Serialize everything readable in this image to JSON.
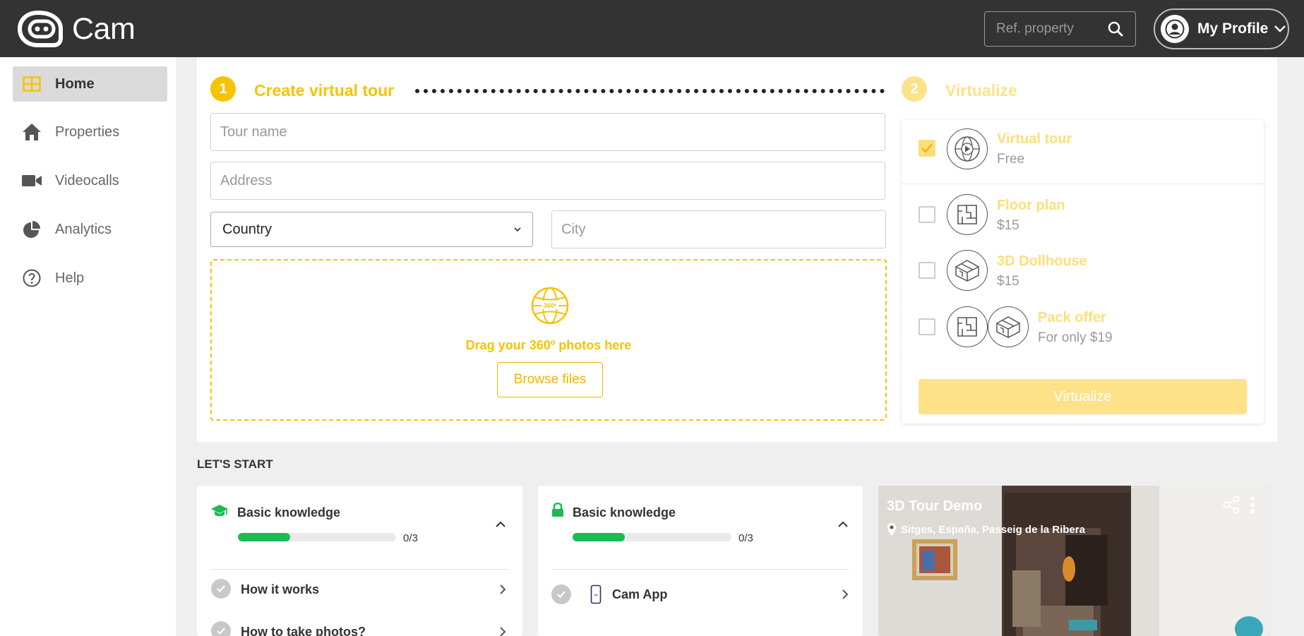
{
  "header": {
    "brand": "Cam",
    "search_placeholder": "Ref. property",
    "profile_label": "My Profile"
  },
  "sidebar": {
    "items": [
      {
        "label": "Home",
        "icon": "grid-icon",
        "active": true
      },
      {
        "label": "Properties",
        "icon": "house-icon",
        "active": false
      },
      {
        "label": "Videocalls",
        "icon": "video-icon",
        "active": false
      },
      {
        "label": "Analytics",
        "icon": "pie-chart-icon",
        "active": false
      },
      {
        "label": "Help",
        "icon": "help-icon",
        "active": false
      }
    ]
  },
  "create": {
    "step_number": "1",
    "title": "Create virtual tour",
    "tour_name_placeholder": "Tour name",
    "address_placeholder": "Address",
    "country_value": "Country",
    "city_placeholder": "City",
    "drop_text": "Drag your 360º photos here",
    "browse_label": "Browse files"
  },
  "virtualize": {
    "step_number": "2",
    "title": "Virtualize",
    "options": [
      {
        "title": "Virtual tour",
        "subtitle": "Free",
        "checked": true
      },
      {
        "title": "Floor plan",
        "subtitle": "$15",
        "checked": false
      },
      {
        "title": "3D Dollhouse",
        "subtitle": "$15",
        "checked": false
      },
      {
        "title": "Pack offer",
        "subtitle": "For only $19",
        "checked": false
      }
    ],
    "button_label": "Virtualize"
  },
  "lets_start": {
    "heading": "LET'S START",
    "cards": [
      {
        "title": "Basic knowledge",
        "progress": 0.33,
        "count": "0/3",
        "items": [
          "How it works",
          "How to take photos?"
        ]
      },
      {
        "title": "Basic knowledge",
        "progress": 0.33,
        "count": "0/3",
        "items": [
          "Cam App"
        ]
      }
    ],
    "tour": {
      "title": "3D Tour Demo",
      "location": "Sitges, España, Passeig de la Ribera"
    }
  },
  "colors": {
    "accent_yellow": "#f5c300",
    "pale_yellow": "#fbdf7a",
    "progress_green": "#1db954",
    "topbar": "#333333"
  }
}
